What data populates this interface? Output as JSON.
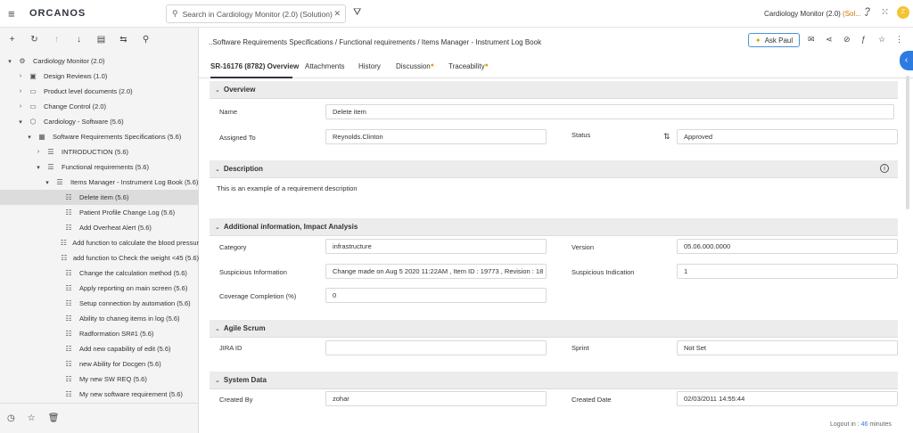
{
  "topbar": {
    "logo": "ORCANOS",
    "search_text": "Search in Cardiology Monitor (2.0)  (Solution) (",
    "project": "Cardiology Monitor (2.0) ",
    "project_suffix": "(Sol...",
    "avatar_letter": "Z"
  },
  "sidebar": {
    "tree": [
      {
        "label": "Cardiology Monitor (2.0)",
        "caret": "▾",
        "icon": "⚙"
      },
      {
        "label": "Design Reviews (1.0)",
        "caret": "›",
        "icon": "▣"
      },
      {
        "label": "Product level documents (2.0)",
        "caret": "›",
        "icon": "▭"
      },
      {
        "label": "Change Control (2.0)",
        "caret": "›",
        "icon": "▭"
      },
      {
        "label": "Cardiology - Software (5.6)",
        "caret": "▾",
        "icon": "⬡"
      },
      {
        "label": "Software Requirements Specifications (5.6)",
        "caret": "▾",
        "icon": "▦"
      },
      {
        "label": "INTRODUCTION (5.6)",
        "caret": "›",
        "icon": "☰"
      },
      {
        "label": "Functional requirements (5.6)",
        "caret": "▾",
        "icon": "☰"
      },
      {
        "label": "Items Manager - Instrument Log Book (5.6)",
        "caret": "▾",
        "icon": "☰"
      },
      {
        "label": "Delete item (5.6)",
        "caret": "",
        "icon": "☷"
      },
      {
        "label": "Patient Profile Change Log (5.6)",
        "caret": "",
        "icon": "☷"
      },
      {
        "label": "Add Overheat Alert (5.6)",
        "caret": "",
        "icon": "☷"
      },
      {
        "label": "Add function to calculate the blood pressur",
        "caret": "",
        "icon": "☷"
      },
      {
        "label": "add function to Check the weight <45 (5.6)",
        "caret": "",
        "icon": "☷"
      },
      {
        "label": "Change the calculation method (5.6)",
        "caret": "",
        "icon": "☷"
      },
      {
        "label": "Apply reporting on main screen (5.6)",
        "caret": "",
        "icon": "☷"
      },
      {
        "label": "Setup connection by automation (5.6)",
        "caret": "",
        "icon": "☷"
      },
      {
        "label": "Ability to chaneg items in log (5.6)",
        "caret": "",
        "icon": "☷"
      },
      {
        "label": "Radformation SR#1 (5.6)",
        "caret": "",
        "icon": "☷"
      },
      {
        "label": "Add new capability of edit (5.6)",
        "caret": "",
        "icon": "☷"
      },
      {
        "label": "new Ability for Docgen (5.6)",
        "caret": "",
        "icon": "☷"
      },
      {
        "label": "My new SW REQ (5.6)",
        "caret": "",
        "icon": "☷"
      },
      {
        "label": "My new software requirement (5.6)",
        "caret": "",
        "icon": "☷"
      }
    ]
  },
  "main": {
    "breadcrumb": "..Software Requirements Specifications / Functional requirements / Items Manager - Instrument Log Book",
    "ask_label": "Ask Paul",
    "tabs": {
      "overview": "SR-16176 (8782) Overview",
      "attachments": "Attachments",
      "history": "History",
      "discussion": "Discussion",
      "traceability": "Traceability"
    },
    "sections": {
      "overview": "Overview",
      "description": "Description",
      "additional": "Additional information, Impact Analysis",
      "agile": "Agile Scrum",
      "system": "System Data"
    },
    "fields": {
      "name_label": "Name",
      "name_value": "Delete item",
      "assigned_label": "Assigned To",
      "assigned_value": "Reynolds.Clinton",
      "status_label": "Status",
      "status_value": "Approved",
      "description_text": "This is an example of a requirement description",
      "category_label": "Category",
      "category_value": "infrastructure",
      "version_label": "Version",
      "version_value": "05.06.000.0000",
      "susp_info_label": "Suspicious Information",
      "susp_info_value": "Change made on Aug 5 2020 11:22AM , Item ID : 19773 , Revision : 18",
      "susp_ind_label": "Suspicious Indication",
      "susp_ind_value": "1",
      "coverage_label": "Coverage Completion (%)",
      "coverage_value": "0",
      "jira_label": "JIRA ID",
      "jira_value": "",
      "sprint_label": "Sprint",
      "sprint_value": "Not Set",
      "created_by_label": "Created By",
      "created_by_value": "zohar",
      "created_date_label": "Created Date",
      "created_date_value": "02/03/2011 14:55:44"
    },
    "logout_prefix": "Logout in : ",
    "logout_minutes": "46",
    "logout_suffix": " minutes"
  }
}
